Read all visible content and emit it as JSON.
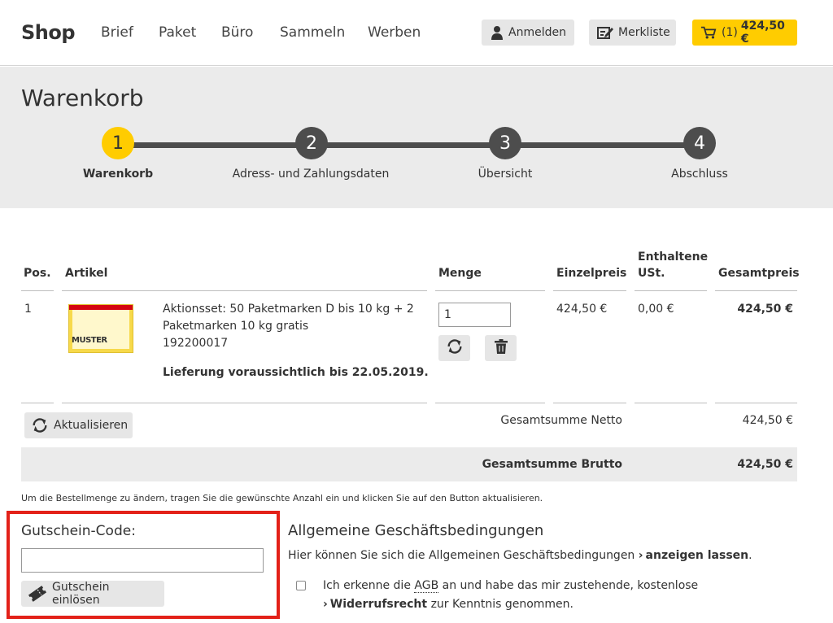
{
  "header": {
    "logo": "Shop",
    "nav": [
      "Brief",
      "Paket",
      "Büro",
      "Sammeln",
      "Werben"
    ],
    "login_label": "Anmelden",
    "watchlist_label": "Merkliste",
    "cart_count": "(1)",
    "cart_total": "424,50 €"
  },
  "checkout": {
    "title": "Warenkorb",
    "steps": [
      {
        "number": "1",
        "label": "Warenkorb",
        "active": true
      },
      {
        "number": "2",
        "label": "Adress- und Zahlungsdaten",
        "active": false
      },
      {
        "number": "3",
        "label": "Übersicht",
        "active": false
      },
      {
        "number": "4",
        "label": "Abschluss",
        "active": false
      }
    ]
  },
  "table": {
    "headers": {
      "pos": "Pos.",
      "article": "Artikel",
      "quantity": "Menge",
      "unit_price": "Einzelpreis",
      "vat_line1": "Enthaltene",
      "vat_line2": "USt.",
      "total": "Gesamtpreis"
    },
    "rows": [
      {
        "pos": "1",
        "title_line1": "Aktionsset: 50 Paketmarken D bis 10 kg + 2",
        "title_line2": "Paketmarken 10 kg gratis",
        "article_number": "192200017",
        "delivery": "Lieferung voraussichtlich bis 22.05.2019.",
        "thumbnail_text": "MUSTER",
        "quantity": "1",
        "unit_price": "424,50 €",
        "vat": "0,00 €",
        "total": "424,50 €"
      }
    ],
    "update_label": "Aktualisieren",
    "net_label": "Gesamtsumme Netto",
    "net_value": "424,50 €",
    "gross_label": "Gesamtsumme Brutto",
    "gross_value": "424,50 €",
    "note": "Um die Bestellmenge zu ändern, tragen Sie die gewünschte Anzahl ein und klicken Sie auf den Button aktualisieren."
  },
  "voucher": {
    "title": "Gutschein-Code:",
    "input_value": "",
    "button_label": "Gutschein einlösen"
  },
  "agb": {
    "title": "Allgemeine Geschäftsbedingungen",
    "text": "Hier können Sie sich die Allgemeinen Geschäftsbedingungen",
    "link": "anzeigen lassen",
    "text_end": ".",
    "check_text_1": "Ich erkenne die",
    "check_abbr": "AGB",
    "check_text_2": "an und habe das mir zustehende, kostenlose",
    "check_link": "Widerrufsrecht",
    "check_text_3": "zur Kenntnis genommen."
  },
  "colors": {
    "accent": "#ffcc00",
    "step_inactive": "#4d4d4d",
    "band": "#ebebeb",
    "highlight_border": "#e32119"
  }
}
